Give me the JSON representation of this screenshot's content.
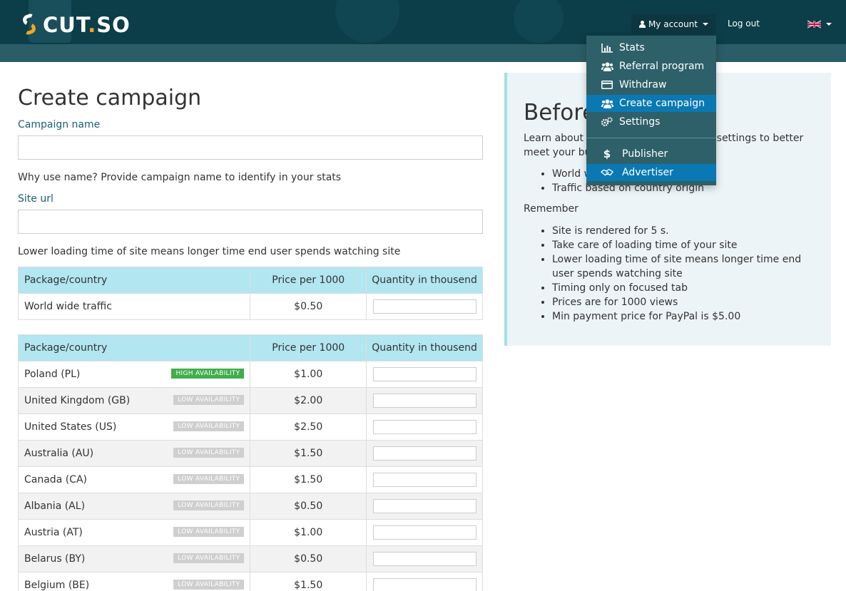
{
  "header": {
    "logo_prefix": "CUT",
    "logo_dot": ".",
    "logo_suffix": "SO",
    "account_label": "My account",
    "logout_label": "Log out",
    "language_flag": "uk-flag-icon"
  },
  "dropdown": {
    "items": [
      {
        "label": "Stats",
        "icon": "bar-chart-icon"
      },
      {
        "label": "Referral program",
        "icon": "users-icon"
      },
      {
        "label": "Withdraw",
        "icon": "credit-card-icon"
      },
      {
        "label": "Create campaign",
        "icon": "users-icon",
        "active": true
      },
      {
        "label": "Settings",
        "icon": "gears-icon"
      },
      {
        "label": "Publisher",
        "icon": "dollar-icon"
      },
      {
        "label": "Advertiser",
        "icon": "handshake-icon",
        "active": true
      }
    ]
  },
  "form": {
    "title": "Create campaign",
    "campaign_name_label": "Campaign name",
    "campaign_name_value": "",
    "campaign_name_help": "Why use name? Provide campaign name to identify in your stats",
    "site_url_label": "Site url",
    "site_url_value": "",
    "site_url_help": "Lower loading time of site means longer time end user spends watching site"
  },
  "table_headers": {
    "package": "Package/country",
    "price": "Price per 1000",
    "quantity": "Quantity in thousend"
  },
  "worldwide": {
    "name": "World wide traffic",
    "price": "$0.50"
  },
  "countries": [
    {
      "name": "Poland (PL)",
      "badge": "HIGH AVAILABILITY",
      "level": "high",
      "price": "$1.00"
    },
    {
      "name": "United Kingdom (GB)",
      "badge": "LOW AVAILABILITY",
      "level": "low",
      "price": "$2.00"
    },
    {
      "name": "United States (US)",
      "badge": "LOW AVAILABILITY",
      "level": "low",
      "price": "$2.50"
    },
    {
      "name": "Australia (AU)",
      "badge": "LOW AVAILABILITY",
      "level": "low",
      "price": "$1.50"
    },
    {
      "name": "Canada (CA)",
      "badge": "LOW AVAILABILITY",
      "level": "low",
      "price": "$1.50"
    },
    {
      "name": "Albania (AL)",
      "badge": "LOW AVAILABILITY",
      "level": "low",
      "price": "$0.50"
    },
    {
      "name": "Austria (AT)",
      "badge": "LOW AVAILABILITY",
      "level": "low",
      "price": "$1.00"
    },
    {
      "name": "Belarus (BY)",
      "badge": "LOW AVAILABILITY",
      "level": "low",
      "price": "$0.50"
    },
    {
      "name": "Belgium (BE)",
      "badge": "LOW AVAILABILITY",
      "level": "low",
      "price": "$1.50"
    }
  ],
  "panel": {
    "title": "Before you start.",
    "intro": "Learn about our campaigns types and settings to better meet your business aims.",
    "types": [
      "World wide traffic",
      "Traffic based on country origin"
    ],
    "remember_label": "Remember",
    "remember_items": [
      "Site is rendered for 5 s.",
      "Take care of loading time of your site",
      "Lower loading time of site means longer time end user spends watching site",
      "Timing only on focused tab",
      "Prices are for 1000 views",
      "Min payment price for PayPal is $5.00"
    ]
  },
  "colors": {
    "header_bg": "#0b3e48",
    "accent_orange": "#f5a623",
    "dropdown_bg": "#2e6069",
    "dropdown_active": "#0a79b3",
    "table_header": "#b2e6f1",
    "badge_high": "#3fae4b",
    "badge_low": "#cfcfcf",
    "label_color": "#1a5f73"
  }
}
